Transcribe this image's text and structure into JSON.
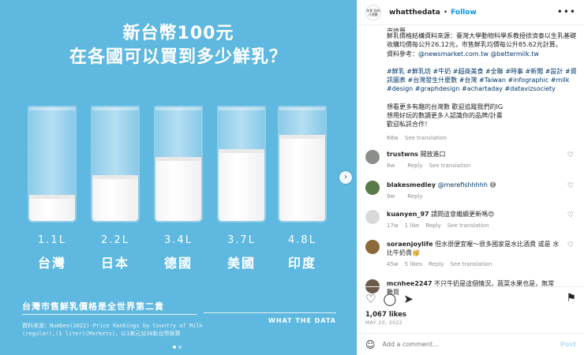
{
  "image": {
    "title_line1": "新台幣100元",
    "title_line2": "在各國可以買到多少鮮乳？",
    "glasses": [
      {
        "volume": "1.1L",
        "country": "台灣",
        "fill": 0.23
      },
      {
        "volume": "2.2L",
        "country": "日本",
        "fill": 0.4
      },
      {
        "volume": "3.4L",
        "country": "德國",
        "fill": 0.56
      },
      {
        "volume": "3.7L",
        "country": "美國",
        "fill": 0.63
      },
      {
        "volume": "4.8L",
        "country": "印度",
        "fill": 0.76
      }
    ],
    "footer_title": "台灣市售鮮乳價格是全世界第二貴",
    "source_text": "資料來源：Numbeo(2022)-Price Rankings by Country of Milk (regular),(1 liter)(Markets)，以1美元兌30新台幣換算",
    "brand": "WHAT THE DATA",
    "colors": {
      "background": "#5fb8df"
    }
  },
  "header": {
    "avatar_text": "你是 我的 什麼數",
    "username": "whatthedata",
    "separator": "•",
    "follow_label": "Follow",
    "more_icon": "•••"
  },
  "caption": {
    "line_cut": "市換算。",
    "line1": "鮮乳價格結構資料來源：臺灣大學動物科學系教授徐濟泰以生乳基礎收購均價每公升26.12元，市售鮮乳均價每公升85.62元計算。",
    "line2_prefix": "資料參考：",
    "line2_links": "@newsmarket.com.tw @bettermilk.tw",
    "hashtags": "#鮮乳 #鮮乳坊 #牛奶 #超商美食 #全聯 #時事 #新聞 #設計 #資訊圖表 #台灣發生什麼數 #台灣 #Taiwan #infographic #milk #design #graphdesign #achartaday #datavizsociety",
    "ending1": "想看更多有趣的台灣數 歡迎追蹤我們的IG",
    "ending2": "想用好玩的數讀更多人認識你的品牌/計畫",
    "ending3": "歡迎私訊合作！",
    "time": "68w",
    "see_translation": "See translation"
  },
  "comments": [
    {
      "user": "trustwns",
      "text": "開放進口",
      "mention": "",
      "time": "8w",
      "likes": "",
      "reply": "Reply",
      "translate": "See translation",
      "avatar_color": "#8a8f8a"
    },
    {
      "user": "blakesmedley",
      "text": " 😅",
      "mention": "@merefishhhhh",
      "time": "9w",
      "likes": "",
      "reply": "Reply",
      "translate": "",
      "avatar_color": "#5a7a4a"
    },
    {
      "user": "kuanyen_97",
      "text": "請問這會繼續更新嗎😍",
      "mention": "",
      "time": "17w",
      "likes": "1 like",
      "reply": "Reply",
      "translate": "See translation",
      "avatar_color": "#d9d9d9"
    },
    {
      "user": "soraenjoylife",
      "text": "但水很便宜喔～很多國家是水比酒貴 或是 水比牛奶貴🥳",
      "mention": "",
      "time": "45w",
      "likes": "5 likes",
      "reply": "Reply",
      "translate": "See translation",
      "avatar_color": "#8a6a3a"
    },
    {
      "user": "mcnhee2247",
      "text": "不只牛奶是這個情況，蔬菜水果也是，無常難買",
      "mention": "",
      "time": "",
      "likes": "",
      "reply": "",
      "translate": "",
      "avatar_color": "#6b5b4b"
    }
  ],
  "actions": {
    "likes": "1,067 likes",
    "date": "MAY 20, 2022",
    "add_comment_placeholder": "Add a comment...",
    "post_label": "Post",
    "icons": [
      "heart-icon",
      "comment-icon",
      "share-icon",
      "bookmark-icon",
      "emoji-icon"
    ]
  }
}
